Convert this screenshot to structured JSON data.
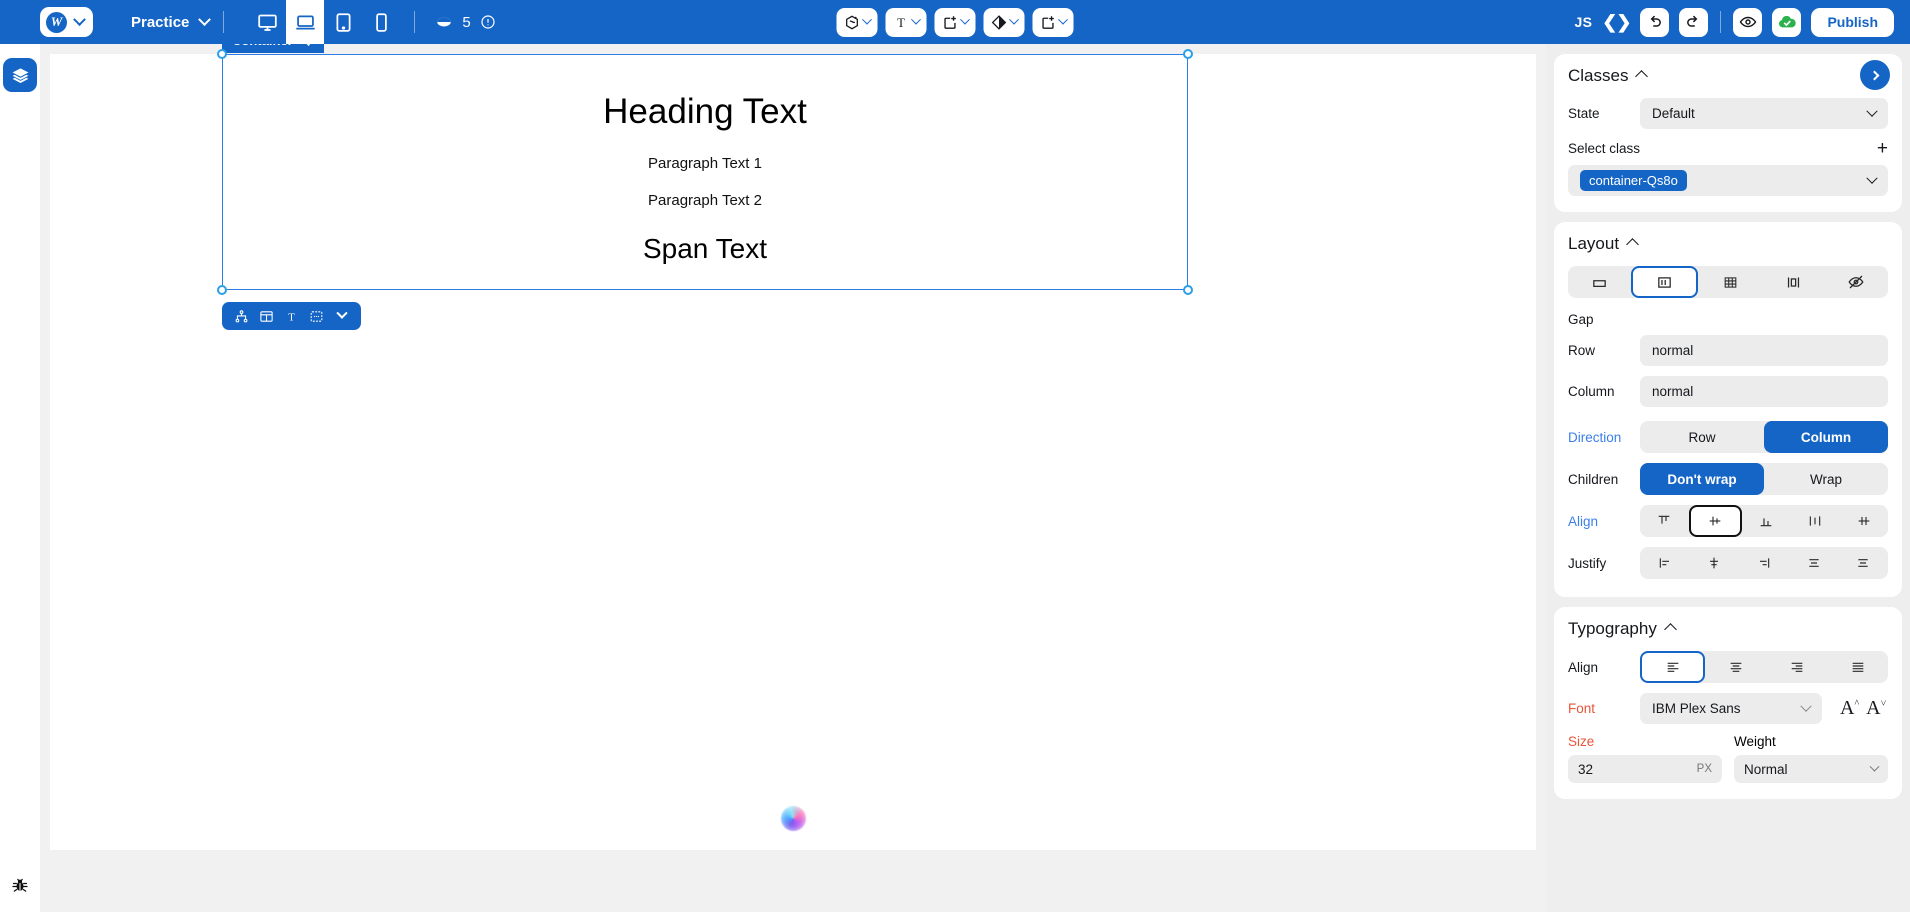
{
  "topbar": {
    "brand_icon": "webflow-logo-icon",
    "brand_chevron": "chevron-down-icon",
    "project_name": "Practice",
    "breakpoints": [
      {
        "name": "desktop-breakpoint",
        "icon": "desktop-icon",
        "active": false
      },
      {
        "name": "laptop-breakpoint",
        "icon": "laptop-icon",
        "active": true
      },
      {
        "name": "tablet-breakpoint",
        "icon": "tablet-icon",
        "active": false
      },
      {
        "name": "mobile-breakpoint",
        "icon": "mobile-icon",
        "active": false
      }
    ],
    "page_count": "5",
    "page_icon": "page-stack-icon",
    "info_icon": "info-circle-icon",
    "center_tools": [
      {
        "name": "component-tool",
        "icon": "component-icon"
      },
      {
        "name": "text-tool",
        "icon": "text-t-icon"
      },
      {
        "name": "add-element-tool",
        "icon": "add-box-icon"
      },
      {
        "name": "style-tool",
        "icon": "contrast-diamond-icon"
      },
      {
        "name": "add-asset-tool",
        "icon": "add-box-icon"
      }
    ],
    "js_label": "JS",
    "code_icon": "code-brackets-icon",
    "undo_icon": "undo-arrow-icon",
    "redo_icon": "redo-arrow-icon",
    "preview_icon": "eye-icon",
    "sync_icon": "cloud-check-icon",
    "publish_label": "Publish"
  },
  "left_rail": {
    "layers_icon": "layers-icon",
    "bug_icon": "bug-icon"
  },
  "canvas": {
    "selection_label": "Container",
    "move_icon": "move-arrows-icon",
    "heading": "Heading Text",
    "paragraph_1": "Paragraph Text 1",
    "paragraph_2": "Paragraph Text 2",
    "span": "Span Text",
    "element_toolbar": [
      {
        "name": "element-tree-icon",
        "glyph": "tree"
      },
      {
        "name": "element-layout-icon",
        "glyph": "layout"
      },
      {
        "name": "element-text-icon",
        "glyph": "text"
      },
      {
        "name": "element-box-icon",
        "glyph": "box"
      },
      {
        "name": "element-more-chevron-icon",
        "glyph": "chevron"
      }
    ],
    "ai_orb_icon": "ai-assistant-orb-icon"
  },
  "panel": {
    "classes": {
      "title": "Classes",
      "collapse_icon": "caret-up-icon",
      "expand_icon": "chevron-right-icon",
      "state_label": "State",
      "state_value": "Default",
      "select_class_label": "Select class",
      "add_class_icon": "plus-icon",
      "class_chip": "container-Qs8o"
    },
    "layout": {
      "title": "Layout",
      "collapse_icon": "caret-up-icon",
      "display_options": [
        {
          "name": "display-block",
          "icon": "block-icon",
          "selected": false
        },
        {
          "name": "display-flex",
          "icon": "flex-icon",
          "selected": true
        },
        {
          "name": "display-grid",
          "icon": "grid-icon",
          "selected": false
        },
        {
          "name": "display-inline-block",
          "icon": "inline-block-icon",
          "selected": false
        },
        {
          "name": "display-none",
          "icon": "eye-slash-icon",
          "selected": false
        }
      ],
      "gap_label": "Gap",
      "row_label": "Row",
      "row_value": "normal",
      "column_label": "Column",
      "column_value": "normal",
      "direction_label": "Direction",
      "direction_options": [
        {
          "label": "Row",
          "selected": false
        },
        {
          "label": "Column",
          "selected": true
        }
      ],
      "children_label": "Children",
      "children_options": [
        {
          "label": "Don't wrap",
          "selected": true
        },
        {
          "label": "Wrap",
          "selected": false
        }
      ],
      "align_label": "Align",
      "align_options": [
        {
          "name": "align-start",
          "selected": false
        },
        {
          "name": "align-center",
          "selected": true
        },
        {
          "name": "align-end",
          "selected": false
        },
        {
          "name": "align-stretch",
          "selected": false
        },
        {
          "name": "align-baseline",
          "selected": false
        }
      ],
      "justify_label": "Justify",
      "justify_options": [
        {
          "name": "justify-start",
          "selected": false
        },
        {
          "name": "justify-center",
          "selected": false
        },
        {
          "name": "justify-end",
          "selected": false
        },
        {
          "name": "justify-space-between",
          "selected": false
        },
        {
          "name": "justify-space-around",
          "selected": false
        }
      ]
    },
    "typography": {
      "title": "Typography",
      "collapse_icon": "caret-up-icon",
      "align_label": "Align",
      "align_options": [
        {
          "name": "text-align-left",
          "selected": true
        },
        {
          "name": "text-align-center",
          "selected": false
        },
        {
          "name": "text-align-right",
          "selected": false
        },
        {
          "name": "text-align-justify",
          "selected": false
        }
      ],
      "font_label": "Font",
      "font_value": "IBM Plex Sans",
      "font_increase_icon": "font-size-up-icon",
      "font_decrease_icon": "font-size-down-icon",
      "size_label": "Size",
      "size_value": "32",
      "size_unit": "PX",
      "weight_label": "Weight",
      "weight_value": "Normal"
    }
  },
  "colors": {
    "brand_blue": "#1565C6",
    "selection_blue": "#2b7de9",
    "accent_label": "#3b7fe8",
    "warn_label": "#e8553b",
    "panel_bg": "#eeeeee",
    "canvas_bg": "#f1f1f1"
  }
}
